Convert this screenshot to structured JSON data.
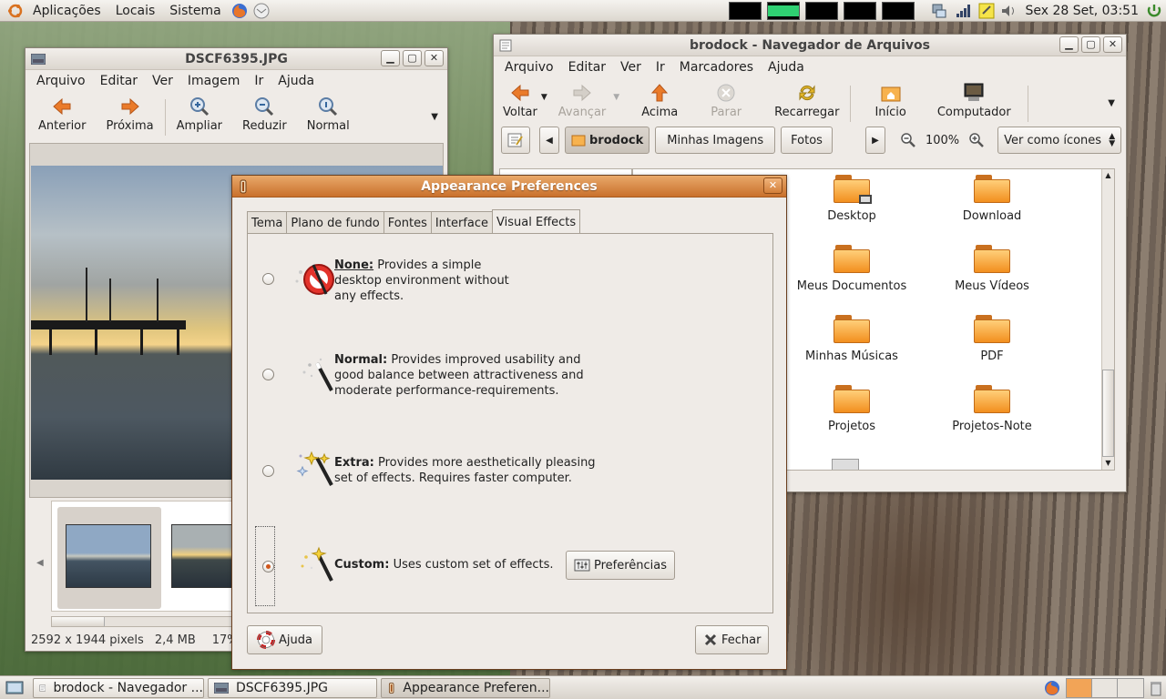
{
  "top_panel": {
    "menus": [
      "Aplicações",
      "Locais",
      "Sistema"
    ],
    "clock": "Sex 28 Set, 03:51"
  },
  "eog": {
    "title": "DSCF6395.JPG",
    "menu": [
      "Arquivo",
      "Editar",
      "Ver",
      "Imagem",
      "Ir",
      "Ajuda"
    ],
    "toolbar": [
      "Anterior",
      "Próxima",
      "Ampliar",
      "Reduzir",
      "Normal"
    ],
    "status": [
      "2592 x 1944 pixels",
      "2,4 MB",
      "17%"
    ]
  },
  "nautilus": {
    "title": "brodock - Navegador de Arquivos",
    "menu": [
      "Arquivo",
      "Editar",
      "Ver",
      "Ir",
      "Marcadores",
      "Ajuda"
    ],
    "toolbar": [
      "Voltar",
      "Avançar",
      "Acima",
      "Parar",
      "Recarregar",
      "Início",
      "Computador"
    ],
    "path": [
      "brodock",
      "Minhas Imagens",
      "Fotos"
    ],
    "zoom": "100%",
    "view_mode": "Ver como ícones",
    "folders": [
      "Desktop",
      "Download",
      "Meus Documentos",
      "Meus Vídeos",
      "Minhas Músicas",
      "PDF",
      "Projetos",
      "Projetos-Note"
    ]
  },
  "appearance": {
    "title": "Appearance Preferences",
    "tabs": [
      "Tema",
      "Plano de fundo",
      "Fontes",
      "Interface",
      "Visual Effects"
    ],
    "effects": [
      {
        "name": "None:",
        "desc": [
          "Provides a simple",
          "desktop environment without",
          "any effects."
        ]
      },
      {
        "name": "Normal:",
        "desc": [
          "Provides improved usability and",
          "good balance between attractiveness and",
          "moderate performance-requirements."
        ]
      },
      {
        "name": "Extra:",
        "desc": [
          "Provides more aesthetically pleasing",
          "set of effects. Requires faster computer."
        ]
      },
      {
        "name": "Custom:",
        "desc": [
          "Uses custom set of effects."
        ]
      }
    ],
    "selected_effect": "Custom",
    "prefs_button": "Preferências",
    "help_button": "Ajuda",
    "close_button": "Fechar"
  },
  "taskbar": [
    "brodock - Navegador ...",
    "DSCF6395.JPG",
    "Appearance Preferen..."
  ],
  "colors": {
    "accent": "#d0561b",
    "title_active": "#c9702c"
  }
}
